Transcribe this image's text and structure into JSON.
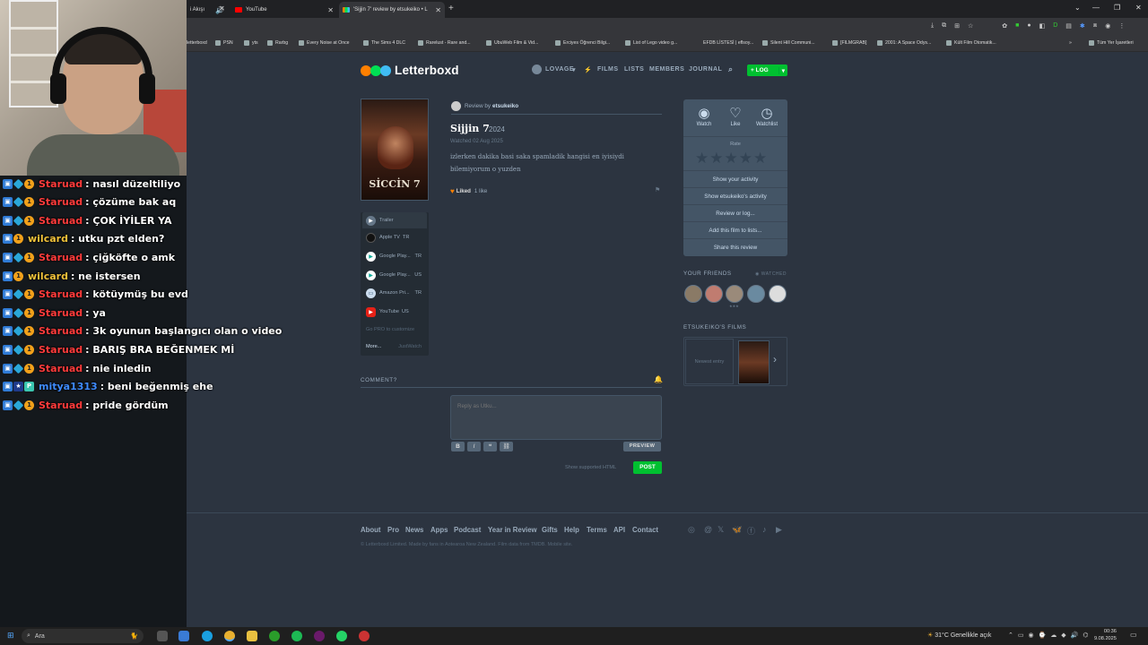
{
  "browser": {
    "tabs": [
      {
        "title": "i Akışı"
      },
      {
        "title": "YouTube"
      },
      {
        "title": "'Sijjin 7' review by etsukeiko • L"
      }
    ],
    "bookmarks": [
      "letterboxd",
      "PSN",
      "yts",
      "Rarbg",
      "Every Noise at Once",
      "The Sims 4 DLC",
      "Rarelust - Rare and...",
      "UbuWeb Film & Vid...",
      "Erciyes Öğrenci Bilgi...",
      "List of Lego video g...",
      "EFDB LİSTESİ | eflsoy...",
      "Silent Hill Communi...",
      "[FILMGRAB]",
      "2001: A Space Odys...",
      "Kült Film Otomatik...",
      "Tüm Yer İşaretleri"
    ]
  },
  "chat": [
    {
      "user": "Staruad",
      "msg": ": nasıl düzeltiliyo",
      "color": "#ff3b3b",
      "badges": [
        "b1",
        "b2",
        "b3"
      ]
    },
    {
      "user": "Staruad",
      "msg": ": çözüme bak aq",
      "color": "#ff3b3b",
      "badges": [
        "b1",
        "b2",
        "b3"
      ]
    },
    {
      "user": "Staruad",
      "msg": ": ÇOK İYİLER YA",
      "color": "#ff3b3b",
      "badges": [
        "b1",
        "b2",
        "b3"
      ]
    },
    {
      "user": "wilcard",
      "msg": ": utku pzt elden?",
      "color": "#f0c13a",
      "badges": [
        "b1",
        "b3"
      ]
    },
    {
      "user": "Staruad",
      "msg": ": çiğköfte o amk",
      "color": "#ff3b3b",
      "badges": [
        "b1",
        "b2",
        "b3"
      ]
    },
    {
      "user": "wilcard",
      "msg": ": ne istersen",
      "color": "#f0c13a",
      "badges": [
        "b1",
        "b3"
      ]
    },
    {
      "user": "Staruad",
      "msg": ": kötüymüş bu evd",
      "color": "#ff3b3b",
      "badges": [
        "b1",
        "b2",
        "b3"
      ]
    },
    {
      "user": "Staruad",
      "msg": ": ya",
      "color": "#ff3b3b",
      "badges": [
        "b1",
        "b2",
        "b3"
      ]
    },
    {
      "user": "Staruad",
      "msg": ": 3k oyunun başlangıcı olan o video",
      "color": "#ff3b3b",
      "badges": [
        "b1",
        "b2",
        "b3"
      ]
    },
    {
      "user": "Staruad",
      "msg": ": BARIŞ BRA BEĞENMEK Mİ",
      "color": "#ff3b3b",
      "badges": [
        "b1",
        "b2",
        "b3"
      ]
    },
    {
      "user": "Staruad",
      "msg": ": nie inledin",
      "color": "#ff3b3b",
      "badges": [
        "b1",
        "b2",
        "b3"
      ]
    },
    {
      "user": "mitya1313",
      "msg": ": beni beğenmiş ehe",
      "color": "#3f8cff",
      "badges": [
        "b1",
        "b4",
        "b5"
      ]
    },
    {
      "user": "Staruad",
      "msg": ": pride gördüm",
      "color": "#ff3b3b",
      "badges": [
        "b1",
        "b2",
        "b3"
      ]
    }
  ],
  "site": {
    "logo": "Letterboxd",
    "nav": {
      "user": "LOVAGE",
      "films": "FILMS",
      "lists": "LISTS",
      "members": "MEMBERS",
      "journal": "JOURNAL",
      "log": "+ LOG"
    },
    "colors": {
      "green": "#00c030",
      "orange": "#ff8000",
      "blue": "#40bcf4",
      "page_bg": "#2c3440"
    }
  },
  "review": {
    "by_prefix": "Review by",
    "author": "etsukeiko",
    "poster_title": "SİCCİN 7",
    "film_title": "Sijjin 7",
    "year": "2024",
    "watched": "Watched 02 Aug 2025",
    "body_line1": "izlerken dakika basi saka spamladik hangisi en iyisiydi",
    "body_line2": "bilemiyorum o yuzden",
    "liked": "Liked",
    "likes": "1 like"
  },
  "where_to_watch": {
    "trailer": "Trailer",
    "services": [
      {
        "name": "Apple TV",
        "region": "TR",
        "color": "#222"
      },
      {
        "name": "Google Play...",
        "region": "TR",
        "color": "#fff"
      },
      {
        "name": "Google Play...",
        "region": "US",
        "color": "#fff"
      },
      {
        "name": "Amazon Pri...",
        "region": "TR",
        "color": "#cde"
      },
      {
        "name": "YouTube",
        "region": "US",
        "color": "#e62117"
      }
    ],
    "go_pro": "Go PRO to customize",
    "more": "More...",
    "justwatch": "JustWatch"
  },
  "actions": {
    "watch": "Watch",
    "like": "Like",
    "watchlist": "Watchlist",
    "rate": "Rate",
    "links": [
      "Show your activity",
      "Show etsukeiko's activity",
      "Review or log...",
      "Add this film to lists...",
      "Share this review"
    ]
  },
  "friends": {
    "heading": "YOUR FRIENDS",
    "watched": "WATCHED",
    "rating_marker": "★★★",
    "avatar_colors": [
      "#8a7a66",
      "#c07c70",
      "#9a8a7a",
      "#6a8aa0",
      "#dddddd"
    ]
  },
  "films": {
    "heading": "ETSUKEIKO'S FILMS",
    "newest": "Newest entry"
  },
  "comment": {
    "heading": "COMMENT?",
    "placeholder": "Reply as Utku...",
    "preview": "PREVIEW",
    "html_note": "Show supported HTML",
    "post": "POST"
  },
  "footer": {
    "links": [
      "About",
      "Pro",
      "News",
      "Apps",
      "Podcast",
      "Year in Review",
      "Gifts",
      "Help",
      "Terms",
      "API",
      "Contact"
    ],
    "copyright": "© Letterboxd Limited. Made by fans in Aotearoa New Zealand. Film data from TMDB. Mobile site."
  },
  "taskbar": {
    "search": "Ara",
    "weather": "31°C  Genellikle açık",
    "time": "00:36",
    "date": "9.08.2025"
  }
}
